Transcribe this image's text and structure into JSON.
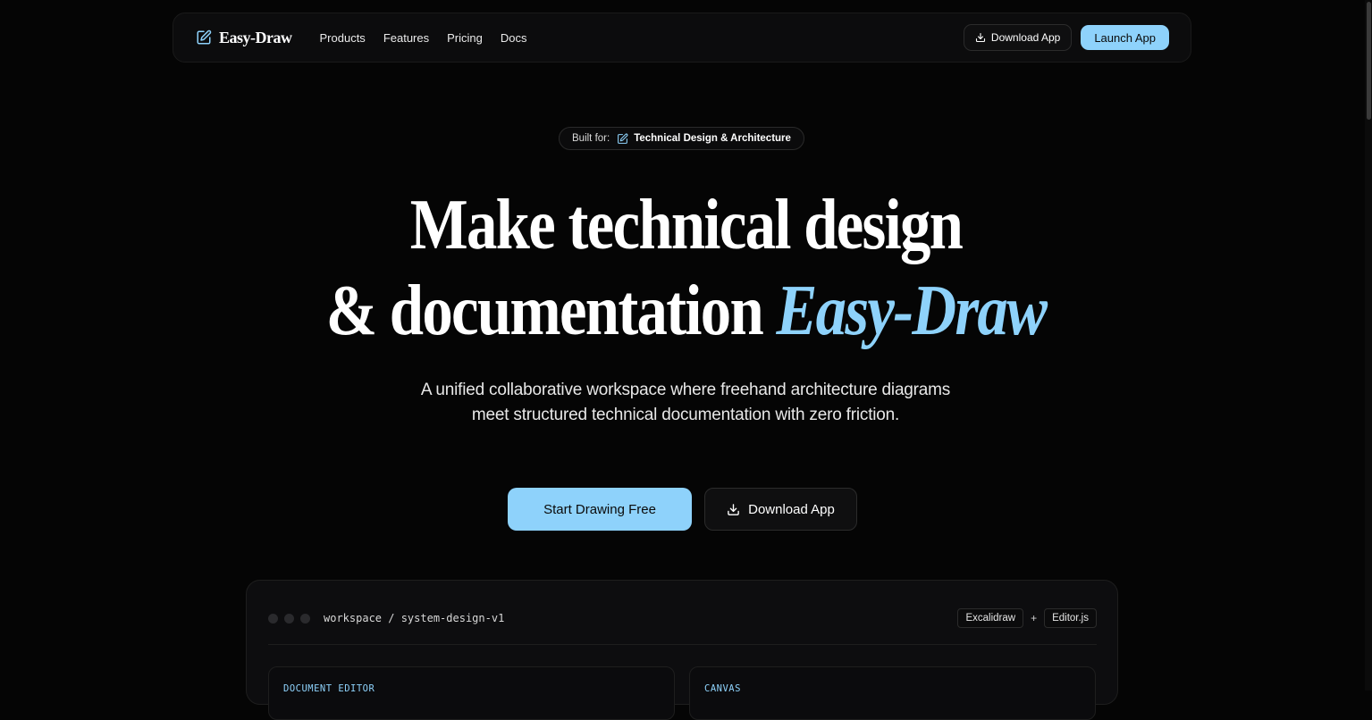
{
  "nav": {
    "brand": "Easy-Draw",
    "links": [
      "Products",
      "Features",
      "Pricing",
      "Docs"
    ],
    "download_label": "Download App",
    "launch_label": "Launch App"
  },
  "badge": {
    "prefix": "Built for:",
    "label": "Technical Design & Architecture"
  },
  "hero": {
    "line1": "Make technical design",
    "line2_plain": "& documentation",
    "line2_accent": "Easy-Draw",
    "subtitle": "A unified collaborative workspace where freehand architecture diagrams meet structured technical documentation with zero friction."
  },
  "cta": {
    "primary": "Start Drawing Free",
    "secondary": "Download App"
  },
  "workspace": {
    "path": "workspace / system-design-v1",
    "tag_left": "Excalidraw",
    "tag_plus": "+",
    "tag_right": "Editor.js",
    "left_label": "DOCUMENT EDITOR",
    "right_label": "CANVAS"
  },
  "colors": {
    "background": "#050505",
    "accent": "#8ed2fb"
  }
}
